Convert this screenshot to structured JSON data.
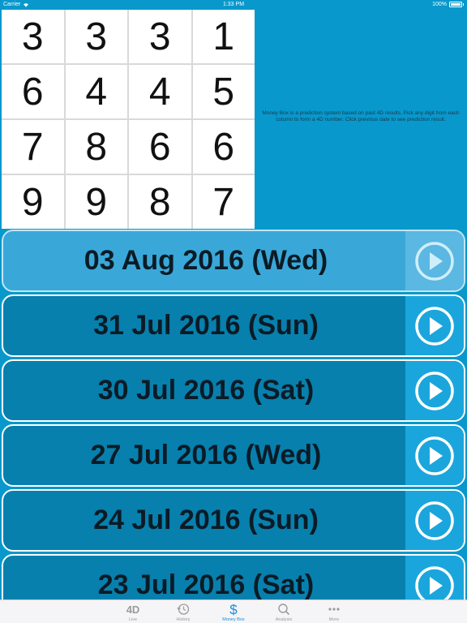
{
  "status_bar": {
    "carrier": "Carrier",
    "time": "1:33 PM",
    "battery": "100%"
  },
  "grid": {
    "rows": [
      [
        "3",
        "3",
        "3",
        "1"
      ],
      [
        "6",
        "4",
        "4",
        "5"
      ],
      [
        "7",
        "8",
        "6",
        "6"
      ],
      [
        "9",
        "9",
        "8",
        "7"
      ]
    ]
  },
  "info": {
    "text": "Money Box is a prediction system based on past 4D results. Pick any digit from each column to form a 4D number. Click previous date to see prediction result."
  },
  "dates": [
    {
      "label": "03 Aug 2016 (Wed)",
      "selected": true
    },
    {
      "label": "31 Jul 2016 (Sun)",
      "selected": false
    },
    {
      "label": "30 Jul 2016 (Sat)",
      "selected": false
    },
    {
      "label": "27 Jul 2016 (Wed)",
      "selected": false
    },
    {
      "label": "24 Jul 2016 (Sun)",
      "selected": false
    },
    {
      "label": "23 Jul 2016 (Sat)",
      "selected": false
    }
  ],
  "tabs": [
    {
      "label": "Live",
      "icon": "4d-icon",
      "active": false
    },
    {
      "label": "History",
      "icon": "history-icon",
      "active": false
    },
    {
      "label": "Money Box",
      "icon": "dollar-icon",
      "active": true
    },
    {
      "label": "Analysis",
      "icon": "search-icon",
      "active": false
    },
    {
      "label": "More",
      "icon": "more-icon",
      "active": false
    }
  ],
  "colors": {
    "background": "#0898cc",
    "row": "#0780ad",
    "row_selected": "#39a8d8",
    "tab_active": "#1a8ad8"
  }
}
